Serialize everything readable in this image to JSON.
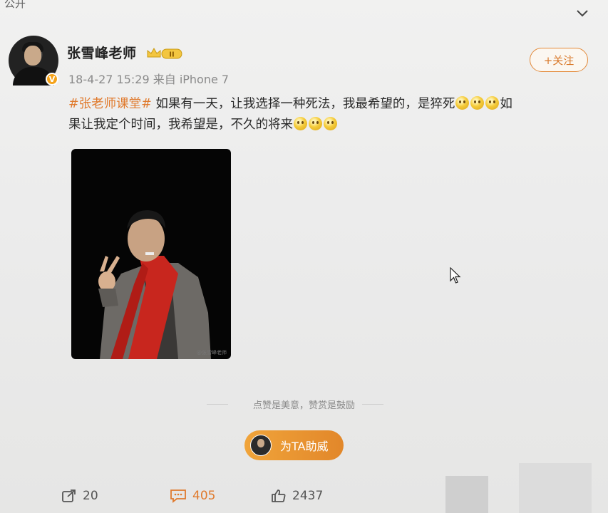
{
  "header": {
    "visibility_label": "公开"
  },
  "author": {
    "name": "张雪峰老师",
    "verified_badge": "V",
    "member_badge": "II",
    "timestamp": "18-4-27 15:29",
    "source": "来自 iPhone 7"
  },
  "follow_button": {
    "label": "+关注"
  },
  "post": {
    "hashtag": "#张老师课堂#",
    "line1": " 如果有一天，让我选择一种死法，我最希望的，是猝死",
    "line1_end": "如",
    "line2": "果让我定个时间，我希望是，不久的将来",
    "emoji_name": "smile-emoji"
  },
  "photo": {
    "watermark": "@张雪峰老师"
  },
  "reward": {
    "divider_text": "点赞是美意，赞赏是鼓励",
    "cheer_button_label": "为TA助威"
  },
  "actions": {
    "repost_count": "20",
    "comment_count": "405",
    "like_count": "2437"
  },
  "colors": {
    "accent": "#e07a2d",
    "cheer_button": "#e9952f"
  }
}
